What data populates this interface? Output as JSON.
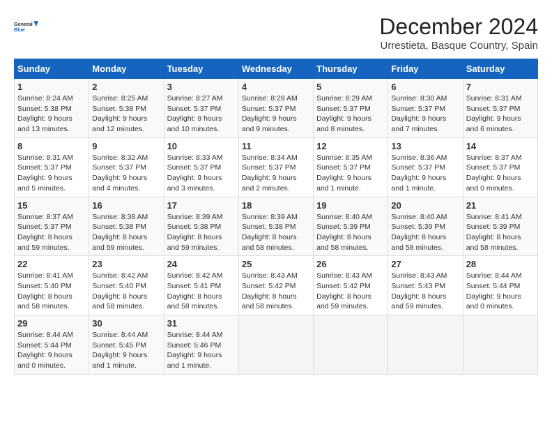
{
  "logo": {
    "line1": "General",
    "line2": "Blue"
  },
  "title": "December 2024",
  "subtitle": "Urrestieta, Basque Country, Spain",
  "weekdays": [
    "Sunday",
    "Monday",
    "Tuesday",
    "Wednesday",
    "Thursday",
    "Friday",
    "Saturday"
  ],
  "weeks": [
    [
      {
        "day": "1",
        "info": "Sunrise: 8:24 AM\nSunset: 5:38 PM\nDaylight: 9 hours\nand 13 minutes."
      },
      {
        "day": "2",
        "info": "Sunrise: 8:25 AM\nSunset: 5:38 PM\nDaylight: 9 hours\nand 12 minutes."
      },
      {
        "day": "3",
        "info": "Sunrise: 8:27 AM\nSunset: 5:37 PM\nDaylight: 9 hours\nand 10 minutes."
      },
      {
        "day": "4",
        "info": "Sunrise: 8:28 AM\nSunset: 5:37 PM\nDaylight: 9 hours\nand 9 minutes."
      },
      {
        "day": "5",
        "info": "Sunrise: 8:29 AM\nSunset: 5:37 PM\nDaylight: 9 hours\nand 8 minutes."
      },
      {
        "day": "6",
        "info": "Sunrise: 8:30 AM\nSunset: 5:37 PM\nDaylight: 9 hours\nand 7 minutes."
      },
      {
        "day": "7",
        "info": "Sunrise: 8:31 AM\nSunset: 5:37 PM\nDaylight: 9 hours\nand 6 minutes."
      }
    ],
    [
      {
        "day": "8",
        "info": "Sunrise: 8:31 AM\nSunset: 5:37 PM\nDaylight: 9 hours\nand 5 minutes."
      },
      {
        "day": "9",
        "info": "Sunrise: 8:32 AM\nSunset: 5:37 PM\nDaylight: 9 hours\nand 4 minutes."
      },
      {
        "day": "10",
        "info": "Sunrise: 8:33 AM\nSunset: 5:37 PM\nDaylight: 9 hours\nand 3 minutes."
      },
      {
        "day": "11",
        "info": "Sunrise: 8:34 AM\nSunset: 5:37 PM\nDaylight: 9 hours\nand 2 minutes."
      },
      {
        "day": "12",
        "info": "Sunrise: 8:35 AM\nSunset: 5:37 PM\nDaylight: 9 hours\nand 1 minute."
      },
      {
        "day": "13",
        "info": "Sunrise: 8:36 AM\nSunset: 5:37 PM\nDaylight: 9 hours\nand 1 minute."
      },
      {
        "day": "14",
        "info": "Sunrise: 8:37 AM\nSunset: 5:37 PM\nDaylight: 9 hours\nand 0 minutes."
      }
    ],
    [
      {
        "day": "15",
        "info": "Sunrise: 8:37 AM\nSunset: 5:37 PM\nDaylight: 8 hours\nand 59 minutes."
      },
      {
        "day": "16",
        "info": "Sunrise: 8:38 AM\nSunset: 5:38 PM\nDaylight: 8 hours\nand 59 minutes."
      },
      {
        "day": "17",
        "info": "Sunrise: 8:39 AM\nSunset: 5:38 PM\nDaylight: 8 hours\nand 59 minutes."
      },
      {
        "day": "18",
        "info": "Sunrise: 8:39 AM\nSunset: 5:38 PM\nDaylight: 8 hours\nand 58 minutes."
      },
      {
        "day": "19",
        "info": "Sunrise: 8:40 AM\nSunset: 5:39 PM\nDaylight: 8 hours\nand 58 minutes."
      },
      {
        "day": "20",
        "info": "Sunrise: 8:40 AM\nSunset: 5:39 PM\nDaylight: 8 hours\nand 58 minutes."
      },
      {
        "day": "21",
        "info": "Sunrise: 8:41 AM\nSunset: 5:39 PM\nDaylight: 8 hours\nand 58 minutes."
      }
    ],
    [
      {
        "day": "22",
        "info": "Sunrise: 8:41 AM\nSunset: 5:40 PM\nDaylight: 8 hours\nand 58 minutes."
      },
      {
        "day": "23",
        "info": "Sunrise: 8:42 AM\nSunset: 5:40 PM\nDaylight: 8 hours\nand 58 minutes."
      },
      {
        "day": "24",
        "info": "Sunrise: 8:42 AM\nSunset: 5:41 PM\nDaylight: 8 hours\nand 58 minutes."
      },
      {
        "day": "25",
        "info": "Sunrise: 8:43 AM\nSunset: 5:42 PM\nDaylight: 8 hours\nand 58 minutes."
      },
      {
        "day": "26",
        "info": "Sunrise: 8:43 AM\nSunset: 5:42 PM\nDaylight: 8 hours\nand 59 minutes."
      },
      {
        "day": "27",
        "info": "Sunrise: 8:43 AM\nSunset: 5:43 PM\nDaylight: 8 hours\nand 59 minutes."
      },
      {
        "day": "28",
        "info": "Sunrise: 8:44 AM\nSunset: 5:44 PM\nDaylight: 9 hours\nand 0 minutes."
      }
    ],
    [
      {
        "day": "29",
        "info": "Sunrise: 8:44 AM\nSunset: 5:44 PM\nDaylight: 9 hours\nand 0 minutes."
      },
      {
        "day": "30",
        "info": "Sunrise: 8:44 AM\nSunset: 5:45 PM\nDaylight: 9 hours\nand 1 minute."
      },
      {
        "day": "31",
        "info": "Sunrise: 8:44 AM\nSunset: 5:46 PM\nDaylight: 9 hours\nand 1 minute."
      },
      null,
      null,
      null,
      null
    ]
  ]
}
